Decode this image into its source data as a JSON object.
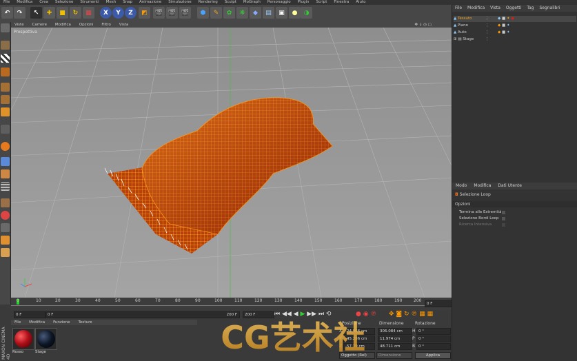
{
  "menu": {
    "items": [
      "File",
      "Modifica",
      "Crea",
      "Selezione",
      "Strumenti",
      "Mesh",
      "Snap",
      "Animazione",
      "Simulazione",
      "Rendering",
      "Sculpt",
      "MoGraph",
      "Personaggio",
      "Plugin",
      "Script",
      "Finestra",
      "Aiuto"
    ]
  },
  "toolbar": {
    "axis_x": "X",
    "axis_y": "Y",
    "axis_z": "Z"
  },
  "viewport": {
    "menu": [
      "Viste",
      "Camere",
      "Modifica",
      "Opzioni",
      "Filtro",
      "Vista"
    ],
    "label": "Prospettiva"
  },
  "timeline": {
    "ticks": [
      "0",
      "10",
      "20",
      "30",
      "40",
      "50",
      "60",
      "70",
      "80",
      "90",
      "100",
      "110",
      "120",
      "130",
      "140",
      "150",
      "160",
      "170",
      "180",
      "190",
      "200"
    ],
    "current_frame": "0 F",
    "start_field": "0 F",
    "slider_field": "0 F",
    "end_slider_label": "200 F",
    "end_field": "200 F"
  },
  "material_panel": {
    "menu": [
      "File",
      "Modifica",
      "Funzione",
      "Texture"
    ],
    "materials": [
      {
        "name": "Rosso",
        "color": "#b0101a"
      },
      {
        "name": "Stage",
        "color": "#0c1626"
      }
    ]
  },
  "coordinates": {
    "headers": [
      "Posizione",
      "Dimensione",
      "Rotazione"
    ],
    "rows": [
      {
        "axis": "X",
        "pos": "-24.956 cm",
        "size": "306.084 cm",
        "rot_axis": "H",
        "rot": "0 °"
      },
      {
        "axis": "Y",
        "pos": "-45.236 cm",
        "size": "11.974 cm",
        "rot_axis": "P",
        "rot": "0 °"
      },
      {
        "axis": "Z",
        "pos": "-57.39 cm",
        "size": "48.711 cm",
        "rot_axis": "B",
        "rot": "0 °"
      }
    ],
    "mode_select": "Oggetto (Rel)",
    "size_select": "Dimensione",
    "apply_button": "Applica"
  },
  "object_manager": {
    "menu": [
      "File",
      "Modifica",
      "Vista",
      "Oggetti",
      "Tag",
      "Segnalibri"
    ],
    "objects": [
      {
        "name": "Tessuto",
        "selected": true
      },
      {
        "name": "Piano",
        "selected": false
      },
      {
        "name": "Auto",
        "selected": false
      },
      {
        "name": "Stage",
        "selected": false
      }
    ]
  },
  "attributes": {
    "menu": [
      "Modo",
      "Modifica",
      "Dati Utente"
    ],
    "tool_name": "Selezione Loop",
    "section": "Opzioni",
    "options": [
      "Termina alle Estremità",
      "Selezione Bordi Loop",
      "Ricerca Intensiva"
    ]
  },
  "branding": {
    "side_logo": "MAXON CINEMA 4D",
    "watermark": "CG艺术社"
  },
  "colors": {
    "accent_blue": "#3c5aa8",
    "cloth_orange": "#e8860f",
    "viewport_grey": "#9c9c9c"
  }
}
